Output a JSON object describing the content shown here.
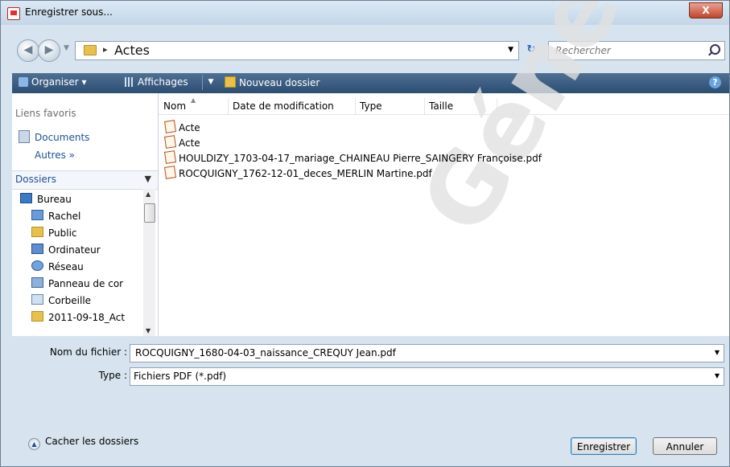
{
  "window": {
    "title": "Enregistrer sous...",
    "close_label": "X"
  },
  "address": {
    "path_segment": "Actes",
    "search_placeholder": "Rechercher"
  },
  "toolbar": {
    "organize": "Organiser ▾",
    "views": "Affichages",
    "new_folder": "Nouveau dossier"
  },
  "sidebar": {
    "favorites_header": "Liens favoris",
    "favorites": [
      {
        "label": "Documents"
      },
      {
        "label": "Autres  »"
      }
    ],
    "folders_header": "Dossiers",
    "tree": [
      {
        "label": "Bureau",
        "icon": "desktop-icon"
      },
      {
        "label": "Rachel",
        "icon": "user-folder-icon"
      },
      {
        "label": "Public",
        "icon": "folder-icon"
      },
      {
        "label": "Ordinateur",
        "icon": "computer-icon"
      },
      {
        "label": "Réseau",
        "icon": "network-icon"
      },
      {
        "label": "Panneau de cor",
        "icon": "control-panel-icon"
      },
      {
        "label": "Corbeille",
        "icon": "recycle-bin-icon"
      },
      {
        "label": "2011-09-18_Act",
        "icon": "folder-icon"
      }
    ]
  },
  "filelist": {
    "columns": [
      "Nom",
      "Date de modification",
      "Type",
      "Taille"
    ],
    "files": [
      {
        "name": "Acte"
      },
      {
        "name": "Acte"
      },
      {
        "name": "HOULDIZY_1703-04-17_mariage_CHAINEAU Pierre_SAINGERY Françoise.pdf"
      },
      {
        "name": "ROCQUIGNY_1762-12-01_deces_MERLIN Martine.pdf"
      }
    ]
  },
  "form": {
    "filename_label": "Nom du fichier :",
    "filename_value": "ROCQUIGNY_1680-04-03_naissance_CREQUY Jean.pdf",
    "type_label": "Type :",
    "type_value": "Fichiers PDF (*.pdf)"
  },
  "footer": {
    "hide_folders": "Cacher les dossiers",
    "save": "Enregistrer",
    "cancel": "Annuler"
  },
  "watermark": "Généalogie"
}
